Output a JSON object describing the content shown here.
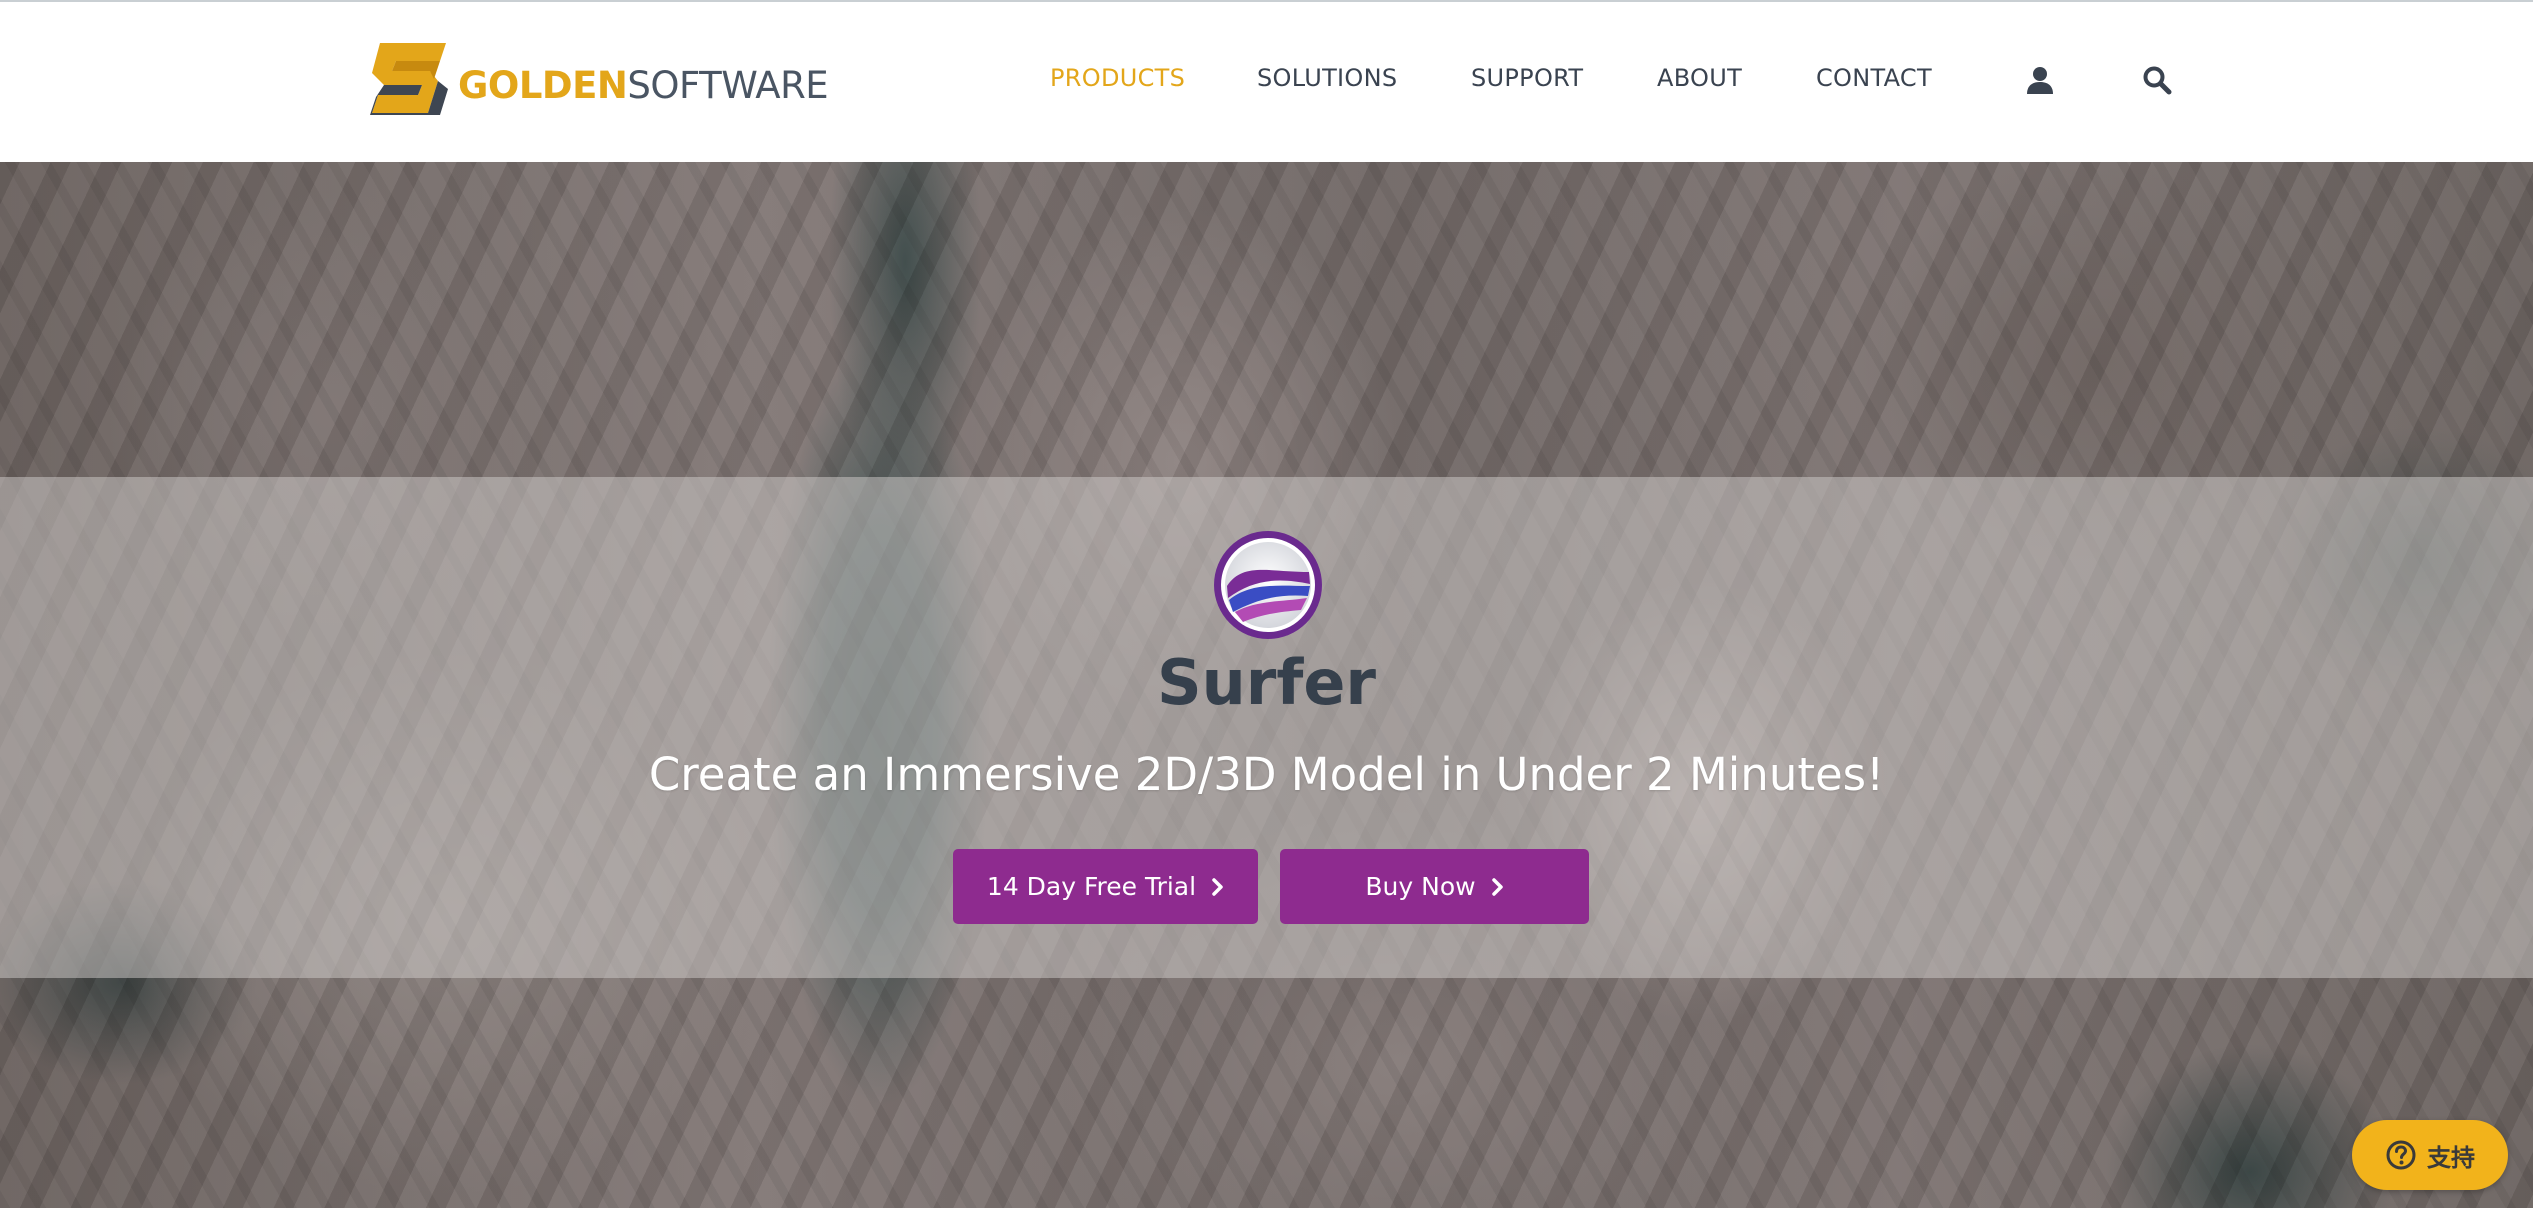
{
  "header": {
    "logo": {
      "word_primary": "GOLDEN",
      "word_secondary": "SOFTWARE"
    },
    "nav": [
      {
        "label": "PRODUCTS",
        "active": true
      },
      {
        "label": "SOLUTIONS",
        "active": false
      },
      {
        "label": "SUPPORT",
        "active": false
      },
      {
        "label": "ABOUT",
        "active": false
      },
      {
        "label": "CONTACT",
        "active": false
      }
    ],
    "icons": {
      "account": "user-icon",
      "search": "search-icon"
    }
  },
  "hero": {
    "product_icon": "surfer-logo-icon",
    "product_name": "Surfer",
    "tagline": "Create an Immersive 2D/3D Model in Under 2 Minutes!",
    "buttons": {
      "trial_label": "14 Day Free Trial",
      "buy_label": "Buy Now"
    }
  },
  "help_widget": {
    "label": "支持",
    "icon": "question-circle-icon"
  },
  "colors": {
    "brand_gold": "#e3a61a",
    "brand_gray": "#4a5563",
    "cta_purple": "#8e2b8f",
    "help_yellow": "#f2b31b",
    "product_name": "#36404c"
  }
}
